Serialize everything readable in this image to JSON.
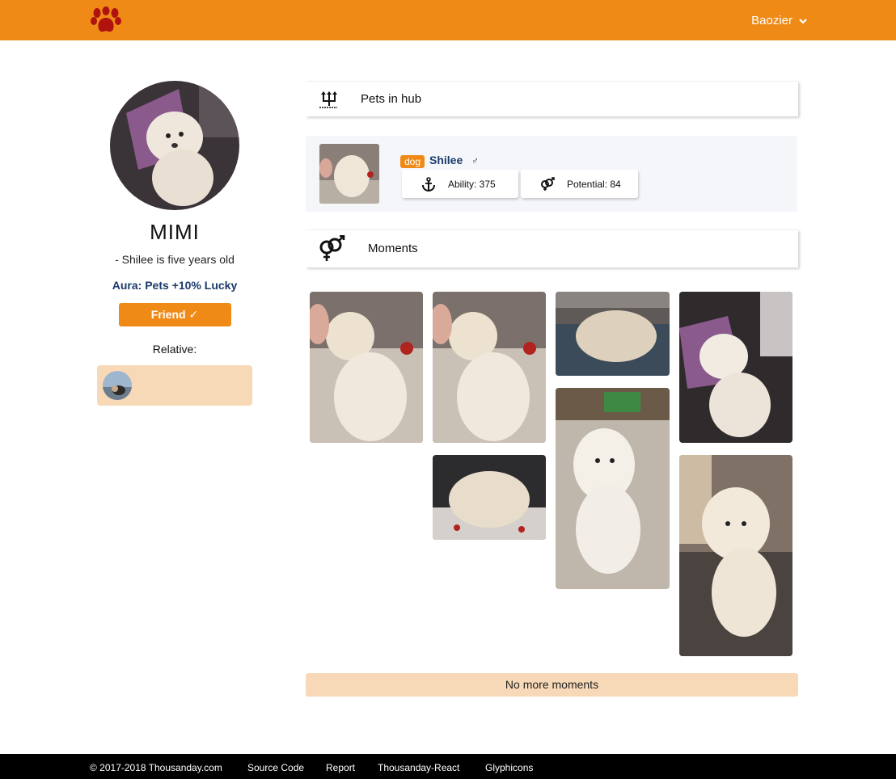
{
  "header": {
    "logo_icon": "paw-icon",
    "username": "Baozier",
    "user_menu_icon": "chevron-down-icon"
  },
  "profile": {
    "name": "MIMI",
    "bio": "- Shilee is five years old",
    "aura": "Aura: Pets +10% Lucky",
    "friend_button": "Friend ✓",
    "relative_label": "Relative:"
  },
  "pets_section": {
    "title": "Pets in hub",
    "icon": "pets-hub-icon",
    "pets": [
      {
        "species": "dog",
        "name": "Shilee",
        "gender_symbol": "♂",
        "ability": "Ability: 375",
        "potential": "Potential: 84"
      }
    ]
  },
  "moments_section": {
    "title": "Moments",
    "icon": "gender-symbol-icon",
    "end_message": "No more moments"
  },
  "footer": {
    "copyright": "© 2017-2018 Thousanday.com",
    "links": [
      "Source Code",
      "Report",
      "Thousanday-React",
      "Glyphicons"
    ]
  },
  "colors": {
    "brand_orange": "#ef8a17",
    "peach": "#f7d9b7",
    "navy_text": "#1b3a6b",
    "footer_bg": "#000000"
  }
}
